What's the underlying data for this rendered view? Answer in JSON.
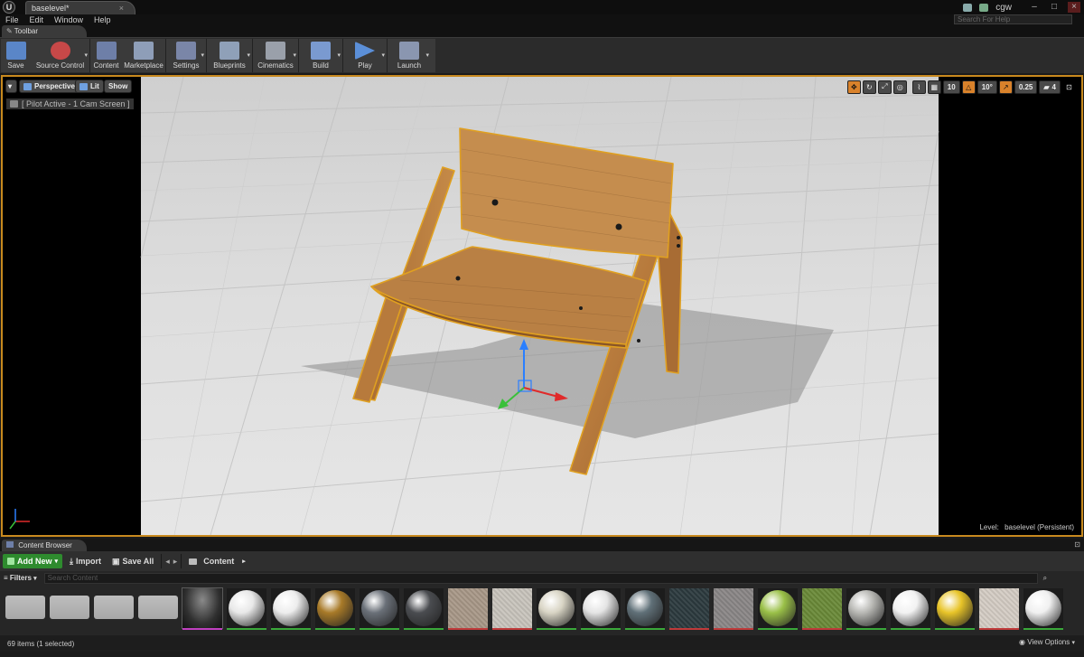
{
  "title_bar": {
    "doc_tab": "baselevel*",
    "user_name": "cgw"
  },
  "menu": {
    "items": [
      "File",
      "Edit",
      "Window",
      "Help"
    ],
    "search_placeholder": "Search For Help"
  },
  "toolbar": {
    "tab_label": "Toolbar",
    "buttons": [
      {
        "label": "Save",
        "icon": "save-icon",
        "color": "#5a86c8"
      },
      {
        "label": "Source Control",
        "icon": "source-control-icon",
        "color": "#c74848"
      },
      {
        "label": "Content",
        "icon": "content-icon",
        "color": "#6e7fa8"
      },
      {
        "label": "Marketplace",
        "icon": "marketplace-icon",
        "color": "#8e9eb8"
      },
      {
        "label": "Settings",
        "icon": "settings-icon",
        "color": "#7a86a8"
      },
      {
        "label": "Blueprints",
        "icon": "blueprints-icon",
        "color": "#8fa0b8"
      },
      {
        "label": "Cinematics",
        "icon": "cinematics-icon",
        "color": "#9aa0aa"
      },
      {
        "label": "Build",
        "icon": "build-icon",
        "color": "#7a9ad0"
      },
      {
        "label": "Play",
        "icon": "play-icon",
        "color": "#5b8fd8"
      },
      {
        "label": "Launch",
        "icon": "launch-icon",
        "color": "#8a96b0"
      }
    ]
  },
  "viewport": {
    "view_mode": "Perspective",
    "lighting_mode": "Lit",
    "show_label": "Show",
    "pilot_label": "[ Pilot Active - 1 Cam Screen ]",
    "grid_snap": "10",
    "rotation_snap": "10°",
    "scale_snap": "0.25",
    "camera_speed": "4",
    "level_prefix": "Level:",
    "level_name": "baselevel (Persistent)"
  },
  "content_browser": {
    "tab_label": "Content Browser",
    "add_new_label": "Add New",
    "import_label": "Import",
    "save_all_label": "Save All",
    "path_label": "Content",
    "filters_label": "Filters",
    "search_placeholder": "Search Content",
    "status_text": "69 items (1 selected)",
    "view_options_label": "View Options",
    "assets": [
      {
        "type": "folder",
        "color": "#a8a8a8",
        "bar": "none"
      },
      {
        "type": "folder",
        "color": "#a8a8a8",
        "bar": "none"
      },
      {
        "type": "folder",
        "color": "#a8a8a8",
        "bar": "none"
      },
      {
        "type": "folder",
        "color": "#a8a8a8",
        "bar": "none"
      },
      {
        "type": "map",
        "color": "#303030",
        "bar": "#c040c0"
      },
      {
        "type": "sphere",
        "color": "#e8e8e8",
        "bar": "#3aa83a"
      },
      {
        "type": "sphere",
        "color": "#ededed",
        "bar": "#3aa83a"
      },
      {
        "type": "sphere",
        "color": "#a87a28",
        "bar": "#3aa83a"
      },
      {
        "type": "sphere",
        "color": "#6a7078",
        "bar": "#3aa83a"
      },
      {
        "type": "sphere",
        "color": "#4a4c50",
        "bar": "#3aa83a"
      },
      {
        "type": "texture",
        "color": "#a89888",
        "bar": "#c03a3a"
      },
      {
        "type": "texture",
        "color": "#c8c4bc",
        "bar": "#c03a3a"
      },
      {
        "type": "sphere",
        "color": "#d8d4c4",
        "bar": "#3aa83a"
      },
      {
        "type": "sphere",
        "color": "#e4e4e4",
        "bar": "#3aa83a"
      },
      {
        "type": "sphere",
        "color": "#607078",
        "bar": "#3aa83a"
      },
      {
        "type": "texture",
        "color": "#2c3a3e",
        "bar": "#c03a3a"
      },
      {
        "type": "texture",
        "color": "#8a8686",
        "bar": "#c03a3a"
      },
      {
        "type": "sphere",
        "color": "#9ac048",
        "bar": "#3aa83a"
      },
      {
        "type": "texture",
        "color": "#6a8a38",
        "bar": "#c03a3a"
      },
      {
        "type": "sphere",
        "color": "#b8b8b4",
        "bar": "#3aa83a"
      },
      {
        "type": "sphere",
        "color": "#f2f2f2",
        "bar": "#3aa83a"
      },
      {
        "type": "sphere",
        "color": "#e8c428",
        "bar": "#3aa83a"
      },
      {
        "type": "texture",
        "color": "#d4ccc4",
        "bar": "#c03a3a"
      },
      {
        "type": "sphere",
        "color": "#f0f0f0",
        "bar": "#3aa83a"
      }
    ]
  },
  "colors": {
    "selection_outline": "#e0a020",
    "wood": "#b77a3c",
    "floor": "#dcdcdc"
  }
}
